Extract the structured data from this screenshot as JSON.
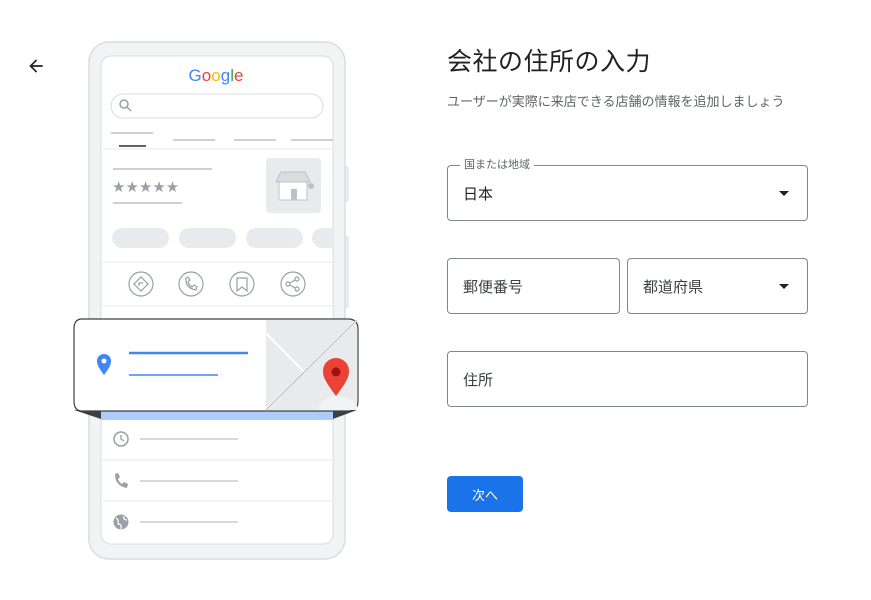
{
  "header": {
    "back_icon": "arrow-left-icon"
  },
  "illustration": {
    "logo_text": "Google",
    "logo_colors": [
      "#4285F4",
      "#EA4335",
      "#FBBC05",
      "#4285F4",
      "#34A853",
      "#EA4335"
    ],
    "stars": "★★★★★",
    "action_icons": [
      "directions-icon",
      "phone-icon",
      "bookmark-icon",
      "share-icon"
    ],
    "info_icons": [
      "clock-icon",
      "phone-icon",
      "globe-icon"
    ]
  },
  "form": {
    "title": "会社の住所の入力",
    "subtitle": "ユーザーが実際に来店できる店舗の情報を追加しましょう",
    "country": {
      "label": "国または地域",
      "value": "日本"
    },
    "postal_code": {
      "placeholder": "郵便番号"
    },
    "prefecture": {
      "placeholder": "都道府県"
    },
    "address": {
      "placeholder": "住所"
    },
    "next_label": "次へ"
  },
  "colors": {
    "primary": "#1a73e8",
    "pin_red": "#ea4335",
    "pin_blue": "#4285f4"
  }
}
